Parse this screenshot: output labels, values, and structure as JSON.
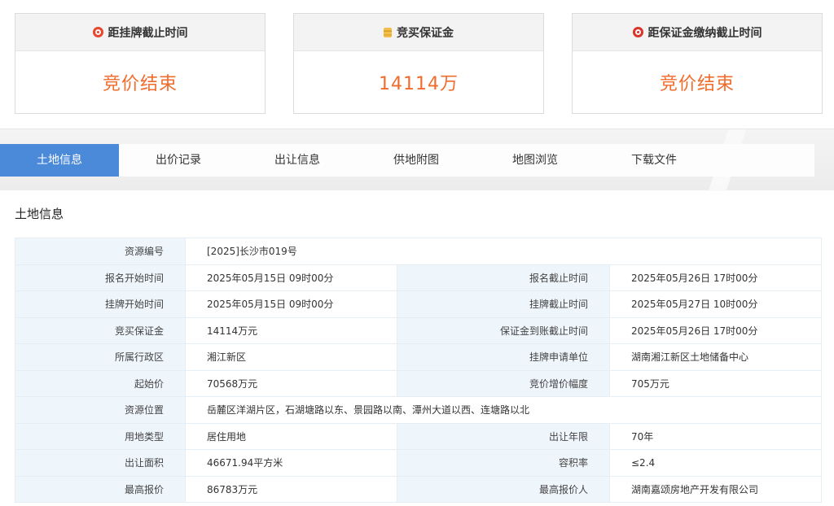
{
  "cards": [
    {
      "label": "距挂牌截止时间",
      "value": "竞价结束",
      "icon": "clock-icon",
      "icon_color": "#e8472f"
    },
    {
      "label": "竞买保证金",
      "value": "14114万",
      "icon": "coins-icon",
      "icon_color": "#e8a82f"
    },
    {
      "label": "距保证金缴纳截止时间",
      "value": "竞价结束",
      "icon": "alarm-icon",
      "icon_color": "#d9352a"
    }
  ],
  "colors": {
    "accent": "#4a8ad8",
    "value_orange": "#f06c2d"
  },
  "tabs": [
    "土地信息",
    "出价记录",
    "出让信息",
    "供地附图",
    "地图浏览",
    "下载文件"
  ],
  "active_tab": 0,
  "section_title": "土地信息",
  "rows": [
    {
      "full": true,
      "k1": "资源编号",
      "v1": "[2025]长沙市019号"
    },
    {
      "k1": "报名开始时间",
      "v1": "2025年05月15日 09时00分",
      "k2": "报名截止时间",
      "v2": "2025年05月26日 17时00分"
    },
    {
      "k1": "挂牌开始时间",
      "v1": "2025年05月15日 09时00分",
      "k2": "挂牌截止时间",
      "v2": "2025年05月27日 10时00分"
    },
    {
      "k1": "竞买保证金",
      "v1": "14114万元",
      "k2": "保证金到账截止时间",
      "v2": "2025年05月26日 17时00分"
    },
    {
      "k1": "所属行政区",
      "v1": "湘江新区",
      "k2": "挂牌申请单位",
      "v2": "湖南湘江新区土地储备中心"
    },
    {
      "k1": "起始价",
      "v1": "70568万元",
      "k2": "竞价增价幅度",
      "v2": "705万元"
    },
    {
      "full": true,
      "k1": "资源位置",
      "v1": "岳麓区洋湖片区，石湖塘路以东、景园路以南、潭州大道以西、连塘路以北"
    },
    {
      "k1": "用地类型",
      "v1": "居住用地",
      "k2": "出让年限",
      "v2": "70年"
    },
    {
      "k1": "出让面积",
      "v1": "46671.94平方米",
      "k2": "容积率",
      "v2": "≤2.4"
    },
    {
      "k1": "最高报价",
      "v1": "86783万元",
      "k2": "最高报价人",
      "v2": "湖南嘉颂房地产开发有限公司"
    }
  ]
}
